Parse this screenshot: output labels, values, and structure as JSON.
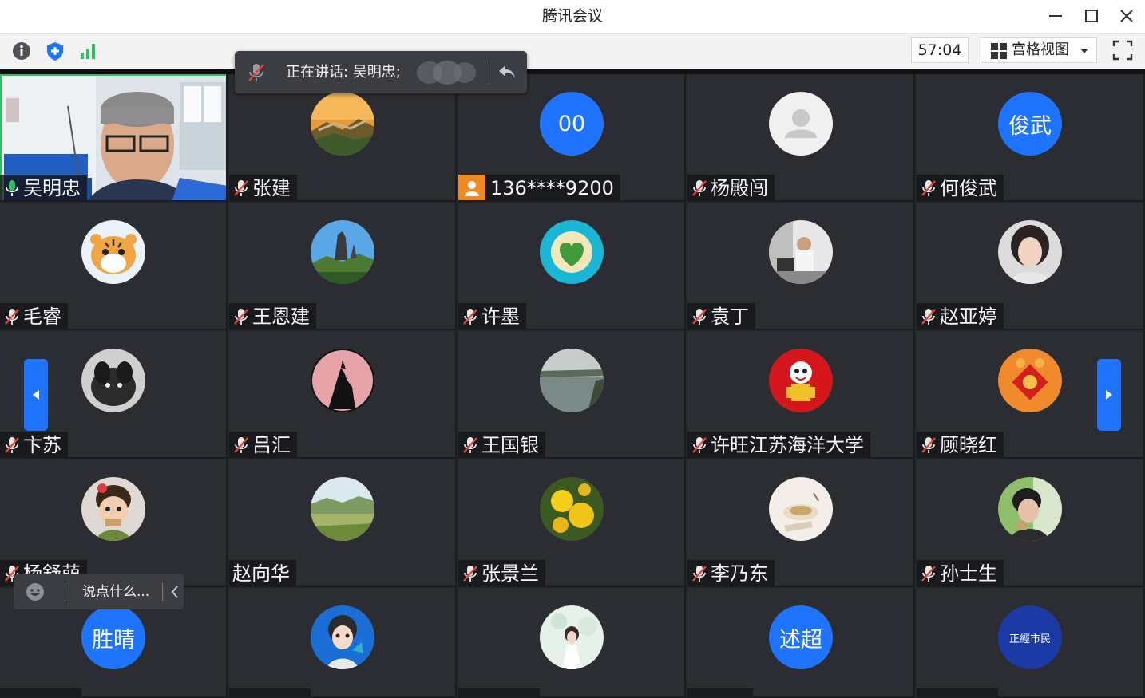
{
  "window": {
    "title": "腾讯会议"
  },
  "toolbar": {
    "timer": "57:04",
    "view_label": "宫格视图"
  },
  "speaking": {
    "label": "正在讲话: 吴明忠;"
  },
  "chat": {
    "placeholder": "说点什么..."
  },
  "colors": {
    "accent": "#1f74ff",
    "active_border": "#2fbe62",
    "phone_badge": "#f28a22"
  },
  "participants": [
    {
      "name": "吴明忠",
      "status": "mic-on",
      "avatar": "video"
    },
    {
      "name": "张建",
      "status": "muted",
      "avatar": "great-wall"
    },
    {
      "name": "136****9200",
      "status": "phone",
      "avatar_text": "00"
    },
    {
      "name": "杨殿闯",
      "status": "muted",
      "avatar": "default-person"
    },
    {
      "name": "何俊武",
      "status": "muted",
      "avatar_text": "俊武"
    },
    {
      "name": "毛睿",
      "status": "muted",
      "avatar": "tiger"
    },
    {
      "name": "王恩建",
      "status": "muted",
      "avatar": "mountain"
    },
    {
      "name": "许墨",
      "status": "muted",
      "avatar": "island"
    },
    {
      "name": "袁丁",
      "status": "muted",
      "avatar": "man-at-desk"
    },
    {
      "name": "赵亚婷",
      "status": "muted",
      "avatar": "woman-portrait"
    },
    {
      "name": "卞苏",
      "status": "muted",
      "avatar": "puppy"
    },
    {
      "name": "吕汇",
      "status": "muted",
      "avatar": "wolf-moon"
    },
    {
      "name": "王国银",
      "status": "muted",
      "avatar": "river"
    },
    {
      "name": "许旺江苏海洋大学",
      "status": "muted",
      "avatar": "cartoon-red"
    },
    {
      "name": "顾晓红",
      "status": "muted",
      "avatar": "fu-tiger"
    },
    {
      "name": "杨舒萌",
      "status": "muted",
      "avatar": "cartoon-girl"
    },
    {
      "name": "赵向华",
      "status": "none",
      "avatar": "grassland"
    },
    {
      "name": "张景兰",
      "status": "muted",
      "avatar": "dandelion"
    },
    {
      "name": "李乃东",
      "status": "muted",
      "avatar": "tea-cup"
    },
    {
      "name": "孙士生",
      "status": "muted",
      "avatar": "boy-portrait"
    },
    {
      "name": "",
      "status": "muted",
      "avatar_text": "胜晴"
    },
    {
      "name": "",
      "status": "muted",
      "avatar": "cartoon-woman"
    },
    {
      "name": "",
      "status": "muted",
      "avatar": "girl-white"
    },
    {
      "name": "",
      "status": "muted",
      "avatar_text": "述超"
    },
    {
      "name": "",
      "status": "muted",
      "avatar_text": "正經市民"
    }
  ]
}
